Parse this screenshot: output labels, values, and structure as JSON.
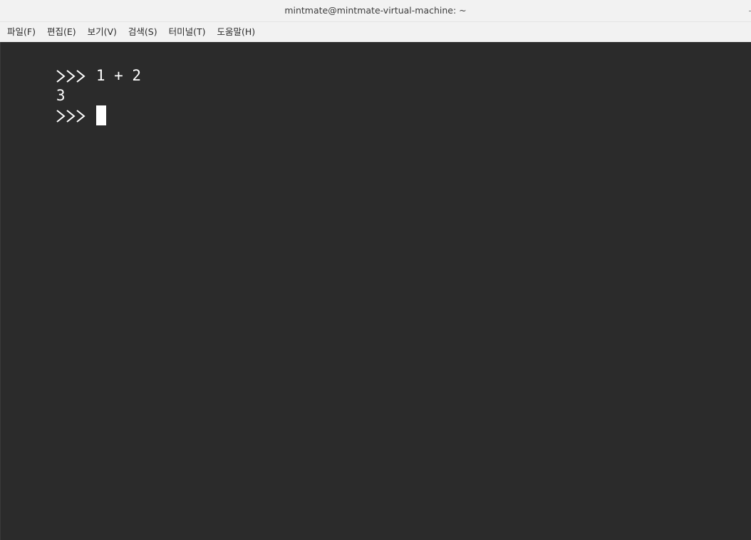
{
  "window": {
    "title": "mintmate@mintmate-virtual-machine: ~"
  },
  "menu": {
    "items": [
      "파일(F)",
      "편집(E)",
      "보기(V)",
      "검색(S)",
      "터미널(T)",
      "도움말(H)"
    ]
  },
  "terminal": {
    "prompt_icon": "triple-chevron-prompt-icon",
    "lines": [
      {
        "type": "input",
        "text": "1 + 2"
      },
      {
        "type": "output",
        "text": "3"
      },
      {
        "type": "input",
        "text": ""
      }
    ],
    "colors": {
      "background": "#2b2b2b",
      "foreground": "#ffffff"
    }
  }
}
